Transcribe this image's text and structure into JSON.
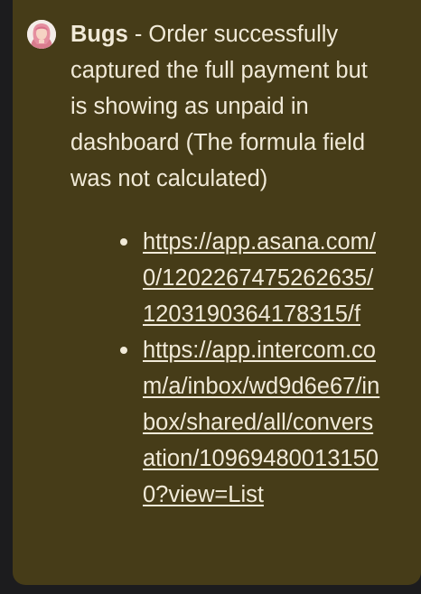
{
  "message": {
    "title": "Bugs",
    "separator": " - ",
    "body": "Order successfully captured the full payment but is showing as unpaid in dashboard (The formula field was not calculated)"
  },
  "links": [
    {
      "text": "https://app.asana.com/0/1202267475262635/1203190364178315/f"
    },
    {
      "text": "https://app.intercom.com/a/inbox/wd9d6e67/inbox/shared/all/conversation/109694800131500?view=List"
    }
  ],
  "colors": {
    "card_background": "#463c18",
    "text": "#f1ead8"
  },
  "icons": {
    "avatar": "user-avatar"
  }
}
